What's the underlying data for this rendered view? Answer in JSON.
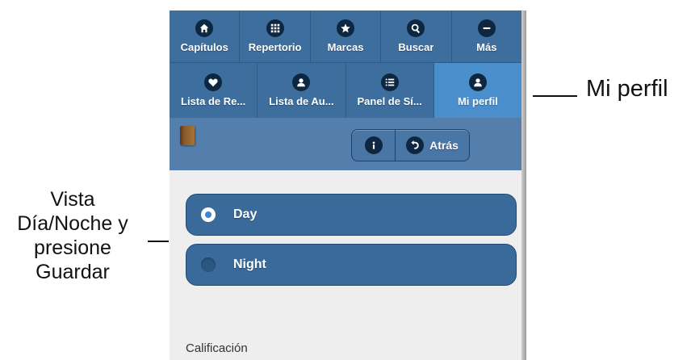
{
  "annotations": {
    "right": "Mi perfil",
    "left_lines": [
      "Vista",
      "Día/Noche y",
      "presione",
      "Guardar"
    ]
  },
  "nav_row1": [
    {
      "label": "Capítulos",
      "icon": "home-icon"
    },
    {
      "label": "Repertorio",
      "icon": "grid-icon"
    },
    {
      "label": "Marcas",
      "icon": "star-icon"
    },
    {
      "label": "Buscar",
      "icon": "search-icon"
    },
    {
      "label": "Más",
      "icon": "minus-icon"
    }
  ],
  "nav_row2": [
    {
      "label": "Lista de Re...",
      "icon": "heart-icon"
    },
    {
      "label": "Lista de Au...",
      "icon": "user-icon"
    },
    {
      "label": "Panel de Sí...",
      "icon": "list-icon"
    },
    {
      "label": "Mi perfil",
      "icon": "user-icon",
      "active": true
    }
  ],
  "toolbar": {
    "back_label": "Atrás",
    "info_icon": "info-icon",
    "back_icon": "undo-icon",
    "book_icon": "book-icon"
  },
  "mode_options": [
    {
      "label": "Day",
      "selected": true
    },
    {
      "label": "Night",
      "selected": false
    }
  ],
  "section_label": "Calificación",
  "colors": {
    "nav": "#3d6e9e",
    "nav_active": "#4a8fcb",
    "toolbar": "#547fad",
    "button": "#3a6a9a"
  }
}
